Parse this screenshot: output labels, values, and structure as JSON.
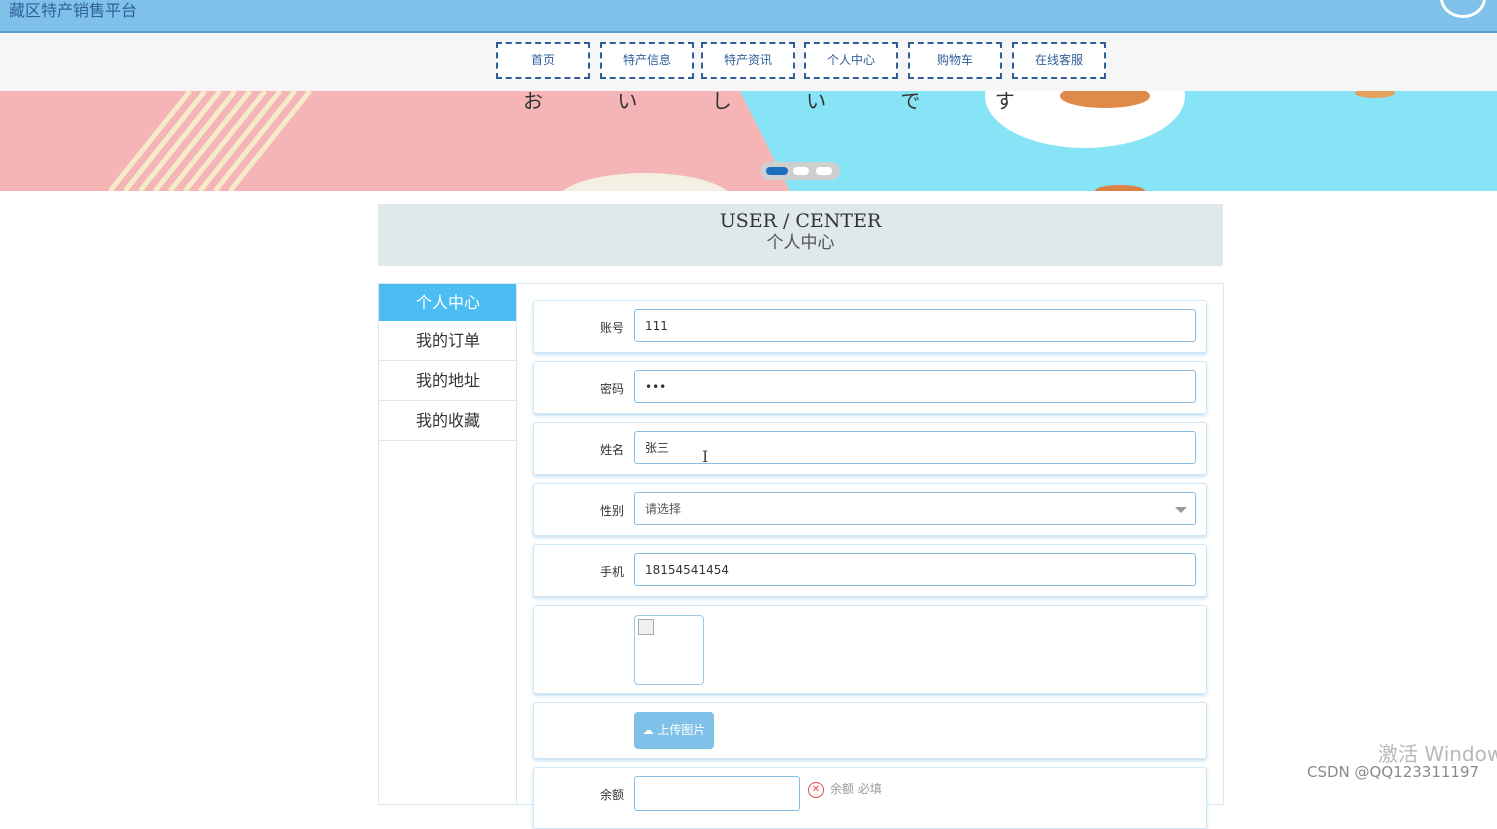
{
  "header": {
    "site_title": "藏区特产销售平台"
  },
  "nav": {
    "items": [
      "首页",
      "特产信息",
      "特产资讯",
      "个人中心",
      "购物车",
      "在线客服"
    ]
  },
  "banner": {
    "text": "お い し い で す"
  },
  "section": {
    "en_title": "USER / CENTER",
    "cn_title": "个人中心"
  },
  "sidebar": {
    "items": [
      {
        "label": "个人中心",
        "active": true
      },
      {
        "label": "我的订单",
        "active": false
      },
      {
        "label": "我的地址",
        "active": false
      },
      {
        "label": "我的收藏",
        "active": false
      }
    ]
  },
  "form": {
    "account_label": "账号",
    "account_value": "111",
    "password_label": "密码",
    "password_value": "•••",
    "name_label": "姓名",
    "name_value": "张三",
    "gender_label": "性别",
    "gender_placeholder": "请选择",
    "phone_label": "手机",
    "phone_value": "18154541454",
    "upload_label": "上传图片",
    "cut_label": "余额",
    "cut_error": "余额 必填"
  },
  "watermark": {
    "activate": "激活 Windows",
    "csdn": "CSDN @QQ123311197"
  },
  "colors": {
    "header_bg": "#7fc1e8",
    "accent": "#4cbdf2",
    "nav_text": "#2f5f9a"
  }
}
